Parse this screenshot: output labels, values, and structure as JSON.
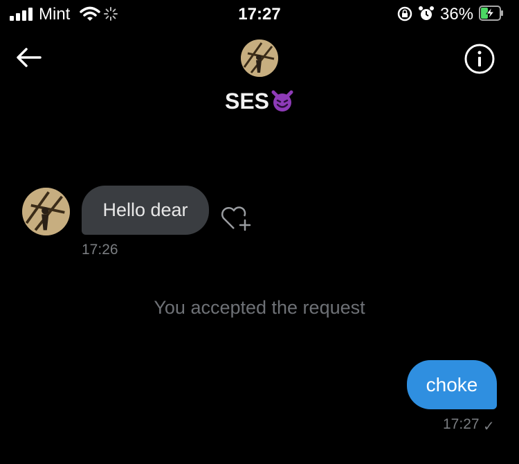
{
  "status_bar": {
    "carrier": "Mint",
    "time": "17:27",
    "battery_percent": "36%",
    "signal_bars": 4,
    "icons": [
      "signal-icon",
      "wifi-icon",
      "loading-spinner-icon",
      "rotation-lock-icon",
      "alarm-icon",
      "battery-charging-icon"
    ]
  },
  "header": {
    "contact_name": "SES",
    "name_emoji": "smiling-devil-emoji",
    "back_icon": "arrow-left-icon",
    "info_icon": "info-circle-icon"
  },
  "messages": [
    {
      "direction": "incoming",
      "text": "Hello dear",
      "time": "17:26"
    },
    {
      "direction": "outgoing",
      "text": "choke",
      "time": "17:27",
      "status": "✓"
    }
  ],
  "system_note": "You accepted the request",
  "colors": {
    "background": "#000000",
    "incoming_bubble": "#3a3d41",
    "outgoing_bubble": "#2f8fe0",
    "muted_text": "#7a7d81",
    "battery_charging": "#4cd964"
  }
}
